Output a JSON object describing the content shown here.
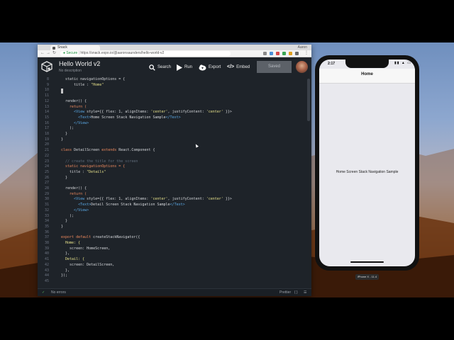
{
  "browser": {
    "tab_title": "Snack",
    "window_user": "Aaron",
    "url_secure": "Secure",
    "url": "https://snack.expo.io/@aaronsaunders/hello-world-v2"
  },
  "header": {
    "project_title": "Hello World v2",
    "project_description": "No description",
    "search_label": "Search",
    "run_label": "Run",
    "export_label": "Export",
    "embed_label": "Embed",
    "saved_label": "Saved"
  },
  "editor": {
    "line_numbers": [
      "8",
      "9",
      "10",
      "11",
      "12",
      "13",
      "14",
      "15",
      "16",
      "17",
      "18",
      "19",
      "20",
      "21",
      "22",
      "23",
      "24",
      "25",
      "26",
      "27",
      "28",
      "29",
      "30",
      "31",
      "32",
      "33",
      "34",
      "35",
      "36",
      "37",
      "38",
      "39",
      "40",
      "41",
      "42",
      "43",
      "44",
      "45"
    ],
    "lines": {
      "l8_a": "static navigationOptions = {",
      "l9_a": "  title : ",
      "l9_b": "\"Home\"",
      "l12": "  render() {",
      "l13_a": "    return (",
      "l14_a": "      <View",
      "l14_b": " style={{ flex: 1, alignItems: ",
      "l14_c": "'center'",
      "l14_d": ", justifyContent: ",
      "l14_e": "'center'",
      "l14_f": " }}>",
      "l15_a": "        <Text>",
      "l15_b": "Home Screen Stack Navigation Sample",
      "l15_c": "</Text>",
      "l16": "      </View>",
      "l17": "    );",
      "l18": "  }",
      "l19": "}",
      "l21_a": "class ",
      "l21_b": "DetailScreen ",
      "l21_c": "extends ",
      "l21_d": "React.Component {",
      "l23": "  // create the title for the screen",
      "l24": "  static navigationOptions = {",
      "l25_a": "    title : ",
      "l25_b": "\"Details\"",
      "l26": "  }",
      "l28": "  render() {",
      "l29": "    return (",
      "l30_a": "      <View",
      "l30_b": " style={{ flex: 1, alignItems: ",
      "l30_c": "'center'",
      "l30_d": ", justifyContent: ",
      "l30_e": "'center'",
      "l30_f": " }}>",
      "l31_a": "        <Text>",
      "l31_b": "Detail Screen Stack Navigation Sample",
      "l31_c": "</Text>",
      "l32": "      </View>",
      "l33": "    );",
      "l34": "  }",
      "l35": "}",
      "l37_a": "export default ",
      "l37_b": "createStackNavigator({",
      "l38": "  Home: {",
      "l39": "    screen: HomeScreen,",
      "l40": "  },",
      "l41": "  Detail: {",
      "l42": "    screen: DetailScreen,",
      "l43": "  },",
      "l44": "});"
    }
  },
  "statusbar": {
    "errors_label": "No errors",
    "prettier_label": "Prettier"
  },
  "phone": {
    "time": "2:17",
    "nav_title": "Home",
    "body_text": "Home Screen Stack Navigation Sample",
    "device_label": "iPhone X - 11.4"
  }
}
